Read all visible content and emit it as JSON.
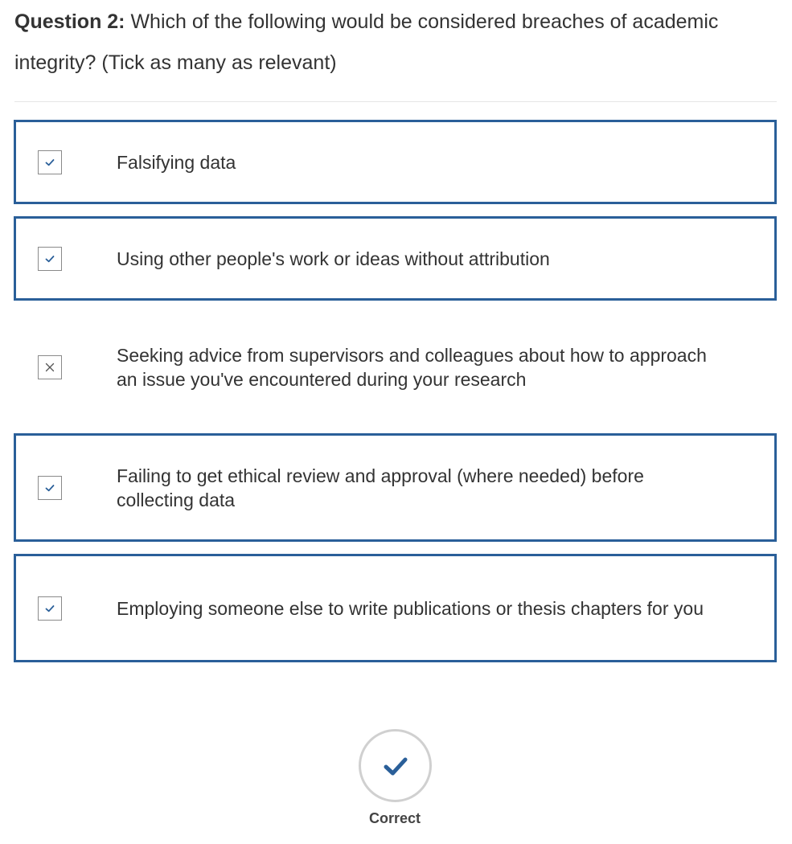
{
  "question": {
    "label": "Question 2:",
    "text": " Which of the following would be considered breaches of academic integrity? (Tick as many as relevant)"
  },
  "options": [
    {
      "text": "Falsifying data",
      "selected": true,
      "mark": "check-icon"
    },
    {
      "text": "Using other people's work or ideas without attribution",
      "selected": true,
      "mark": "check-icon"
    },
    {
      "text": "Seeking advice from supervisors and colleagues about how to approach an issue you've encountered during your research",
      "selected": false,
      "mark": "cross-icon"
    },
    {
      "text": "Failing to get ethical review and approval (where needed) before collecting data",
      "selected": true,
      "mark": "check-icon"
    },
    {
      "text": "Employing someone else to write publications or thesis chapters for you",
      "selected": true,
      "mark": "check-icon"
    }
  ],
  "result": {
    "label": "Correct",
    "icon": "checkmark-icon"
  },
  "colors": {
    "accent": "#2a5f99",
    "text": "#333333",
    "border_muted": "#d0d0d0"
  }
}
